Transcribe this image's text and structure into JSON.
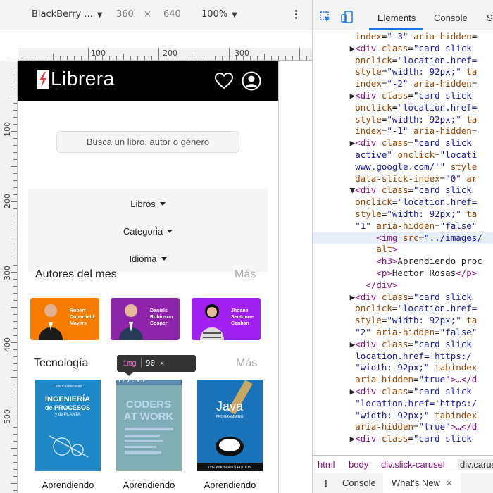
{
  "toolbar": {
    "device": "BlackBerry ...",
    "width": "360",
    "times": "×",
    "height": "640",
    "zoom": "100%"
  },
  "ruler": {
    "top_labels": [
      "100",
      "200",
      "300"
    ],
    "left_labels": [
      "100",
      "200",
      "300",
      "400",
      "500"
    ]
  },
  "app": {
    "brand": "Librera",
    "search_placeholder": "Busca un libro, autor o género",
    "filters": [
      "Libros",
      "Categoria",
      "Idioma"
    ],
    "authors_section": {
      "title": "Autores del mes",
      "more": "Más"
    },
    "authors": [
      {
        "name": "Robert Coperfield Mayers",
        "color": "#f57c00"
      },
      {
        "name": "Daniels Robinson Cooper",
        "color": "#8e24aa"
      },
      {
        "name": "Jhoane Seotonne Canban",
        "color": "#a020f0"
      }
    ],
    "tech_section": {
      "title": "Tecnología",
      "more": "Más"
    },
    "books": [
      {
        "title_lines": [
          "INGENIERÍA",
          "de PROCESOS",
          "y de PLANTA"
        ],
        "author": "Lluís Cuatrecasas",
        "label": "Aprendiendo",
        "color": "#1e88c8"
      },
      {
        "title_lines": [
          "CODERS",
          "AT WORK"
        ],
        "author": "",
        "label": "Aprendiendo",
        "color": "#8fb29a"
      },
      {
        "title_lines": [
          "Java",
          "PROGRAMMING"
        ],
        "author": "THE WIKIBOOKS EDITION",
        "label": "Aprendiendo",
        "color": "#1a73b8"
      }
    ],
    "tooltip": {
      "tag": "img",
      "size": "90 × 127.13"
    }
  },
  "devtools": {
    "tabs": [
      "Elements",
      "Console",
      "So"
    ],
    "code_lines": [
      [
        [
          "txt",
          "        "
        ],
        [
          "attr",
          "index"
        ],
        [
          "txt",
          "="
        ],
        [
          "val",
          "\"-3\""
        ],
        [
          "txt",
          " "
        ],
        [
          "attr",
          "aria-hidden"
        ],
        [
          "txt",
          "="
        ]
      ],
      [
        [
          "txt",
          "       ▶"
        ],
        [
          "tag",
          "<div "
        ],
        [
          "attr",
          "class"
        ],
        [
          "txt",
          "="
        ],
        [
          "val",
          "\"card slick"
        ]
      ],
      [
        [
          "txt",
          "        "
        ],
        [
          "attr",
          "onclick"
        ],
        [
          "txt",
          "="
        ],
        [
          "val",
          "\"location.href="
        ]
      ],
      [
        [
          "txt",
          "        "
        ],
        [
          "attr",
          "style"
        ],
        [
          "txt",
          "="
        ],
        [
          "val",
          "\"width: 92px;\""
        ],
        [
          "txt",
          " "
        ],
        [
          "attr",
          "ta"
        ]
      ],
      [
        [
          "txt",
          "        "
        ],
        [
          "attr",
          "index"
        ],
        [
          "txt",
          "="
        ],
        [
          "val",
          "\"-2\""
        ],
        [
          "txt",
          " "
        ],
        [
          "attr",
          "aria-hidden"
        ],
        [
          "txt",
          "="
        ]
      ],
      [
        [
          "txt",
          "       ▶"
        ],
        [
          "tag",
          "<div "
        ],
        [
          "attr",
          "class"
        ],
        [
          "txt",
          "="
        ],
        [
          "val",
          "\"card slick"
        ]
      ],
      [
        [
          "txt",
          "        "
        ],
        [
          "attr",
          "onclick"
        ],
        [
          "txt",
          "="
        ],
        [
          "val",
          "\"location.href="
        ]
      ],
      [
        [
          "txt",
          "        "
        ],
        [
          "attr",
          "style"
        ],
        [
          "txt",
          "="
        ],
        [
          "val",
          "\"width: 92px;\""
        ],
        [
          "txt",
          " "
        ],
        [
          "attr",
          "ta"
        ]
      ],
      [
        [
          "txt",
          "        "
        ],
        [
          "attr",
          "index"
        ],
        [
          "txt",
          "="
        ],
        [
          "val",
          "\"-1\""
        ],
        [
          "txt",
          " "
        ],
        [
          "attr",
          "aria-hidden"
        ],
        [
          "txt",
          "="
        ]
      ],
      [
        [
          "txt",
          "       ▶"
        ],
        [
          "tag",
          "<div "
        ],
        [
          "attr",
          "class"
        ],
        [
          "txt",
          "="
        ],
        [
          "val",
          "\"card slick"
        ]
      ],
      [
        [
          "txt",
          "        "
        ],
        [
          "val",
          "active\""
        ],
        [
          "txt",
          " "
        ],
        [
          "attr",
          "onclick"
        ],
        [
          "txt",
          "="
        ],
        [
          "val",
          "\"locati"
        ]
      ],
      [
        [
          "txt",
          "        "
        ],
        [
          "val",
          "www.google.com/'\""
        ],
        [
          "txt",
          " "
        ],
        [
          "attr",
          "style"
        ]
      ],
      [
        [
          "txt",
          "        "
        ],
        [
          "attr",
          "data-slick-index"
        ],
        [
          "txt",
          "="
        ],
        [
          "val",
          "\"0\""
        ],
        [
          "txt",
          " "
        ],
        [
          "attr",
          "ar"
        ]
      ],
      [
        [
          "txt",
          "       ▼"
        ],
        [
          "tag",
          "<div "
        ],
        [
          "attr",
          "class"
        ],
        [
          "txt",
          "="
        ],
        [
          "val",
          "\"card slick"
        ]
      ],
      [
        [
          "txt",
          "        "
        ],
        [
          "attr",
          "onclick"
        ],
        [
          "txt",
          "="
        ],
        [
          "val",
          "\"location.href="
        ]
      ],
      [
        [
          "txt",
          "        "
        ],
        [
          "attr",
          "style"
        ],
        [
          "txt",
          "="
        ],
        [
          "val",
          "\"width: 92px;\""
        ],
        [
          "txt",
          " "
        ],
        [
          "attr",
          "ta"
        ]
      ],
      [
        [
          "txt",
          "        "
        ],
        [
          "val",
          "\"1\""
        ],
        [
          "txt",
          " "
        ],
        [
          "attr",
          "aria-hidden"
        ],
        [
          "txt",
          "="
        ],
        [
          "val",
          "\"false\""
        ]
      ],
      [
        [
          "txt",
          "            "
        ],
        [
          "tag",
          "<img "
        ],
        [
          "attr",
          "src"
        ],
        [
          "txt",
          "="
        ],
        [
          "link",
          "\"../images/"
        ]
      ],
      [
        [
          "txt",
          "            "
        ],
        [
          "attr",
          "alt"
        ],
        [
          "tag",
          ">"
        ]
      ],
      [
        [
          "txt",
          "            "
        ],
        [
          "tag",
          "<h3>"
        ],
        [
          "txt",
          "Aprendiendo proc"
        ]
      ],
      [
        [
          "txt",
          "            "
        ],
        [
          "tag",
          "<p>"
        ],
        [
          "txt",
          "Hector Rosas"
        ],
        [
          "tag",
          "</p>"
        ],
        [
          "txt",
          " "
        ]
      ],
      [
        [
          "txt",
          "          "
        ],
        [
          "tag",
          "</div>"
        ]
      ],
      [
        [
          "txt",
          "       ▶"
        ],
        [
          "tag",
          "<div "
        ],
        [
          "attr",
          "class"
        ],
        [
          "txt",
          "="
        ],
        [
          "val",
          "\"card slick"
        ]
      ],
      [
        [
          "txt",
          "        "
        ],
        [
          "attr",
          "onclick"
        ],
        [
          "txt",
          "="
        ],
        [
          "val",
          "\"location.href="
        ]
      ],
      [
        [
          "txt",
          "        "
        ],
        [
          "attr",
          "style"
        ],
        [
          "txt",
          "="
        ],
        [
          "val",
          "\"width: 92px;\""
        ],
        [
          "txt",
          " "
        ],
        [
          "attr",
          "ta"
        ]
      ],
      [
        [
          "txt",
          "        "
        ],
        [
          "val",
          "\"2\""
        ],
        [
          "txt",
          " "
        ],
        [
          "attr",
          "aria-hidden"
        ],
        [
          "txt",
          "="
        ],
        [
          "val",
          "\"false\""
        ]
      ],
      [
        [
          "txt",
          "       ▶"
        ],
        [
          "tag",
          "<div "
        ],
        [
          "attr",
          "class"
        ],
        [
          "txt",
          "="
        ],
        [
          "val",
          "\"card slick"
        ]
      ],
      [
        [
          "txt",
          "        "
        ],
        [
          "val",
          "location.href='https:/"
        ]
      ],
      [
        [
          "txt",
          "        "
        ],
        [
          "val",
          "\"width: 92px;\""
        ],
        [
          "txt",
          " "
        ],
        [
          "attr",
          "tabindex"
        ]
      ],
      [
        [
          "txt",
          "        "
        ],
        [
          "attr",
          "aria-hidden"
        ],
        [
          "txt",
          "="
        ],
        [
          "val",
          "\"true\""
        ],
        [
          "tag",
          ">…</d"
        ]
      ],
      [
        [
          "txt",
          "       ▶"
        ],
        [
          "tag",
          "<div "
        ],
        [
          "attr",
          "class"
        ],
        [
          "txt",
          "="
        ],
        [
          "val",
          "\"card slick"
        ]
      ],
      [
        [
          "txt",
          "        "
        ],
        [
          "val",
          "\"location.href='https:/"
        ]
      ],
      [
        [
          "txt",
          "        "
        ],
        [
          "val",
          "\"width: 92px;\""
        ],
        [
          "txt",
          " "
        ],
        [
          "attr",
          "tabindex"
        ]
      ],
      [
        [
          "txt",
          "        "
        ],
        [
          "attr",
          "aria-hidden"
        ],
        [
          "txt",
          "="
        ],
        [
          "val",
          "\"true\""
        ],
        [
          "tag",
          ">…</d"
        ]
      ],
      [
        [
          "txt",
          "       ▶"
        ],
        [
          "tag",
          "<div "
        ],
        [
          "attr",
          "class"
        ],
        [
          "txt",
          "="
        ],
        [
          "val",
          "\"card slick"
        ]
      ]
    ],
    "selected_line": 17,
    "breadcrumbs": [
      "html",
      "body",
      "div.slick-carusel",
      "div.carus"
    ],
    "drawer": {
      "console": "Console",
      "whats_new": "What's New",
      "close": "×"
    }
  }
}
